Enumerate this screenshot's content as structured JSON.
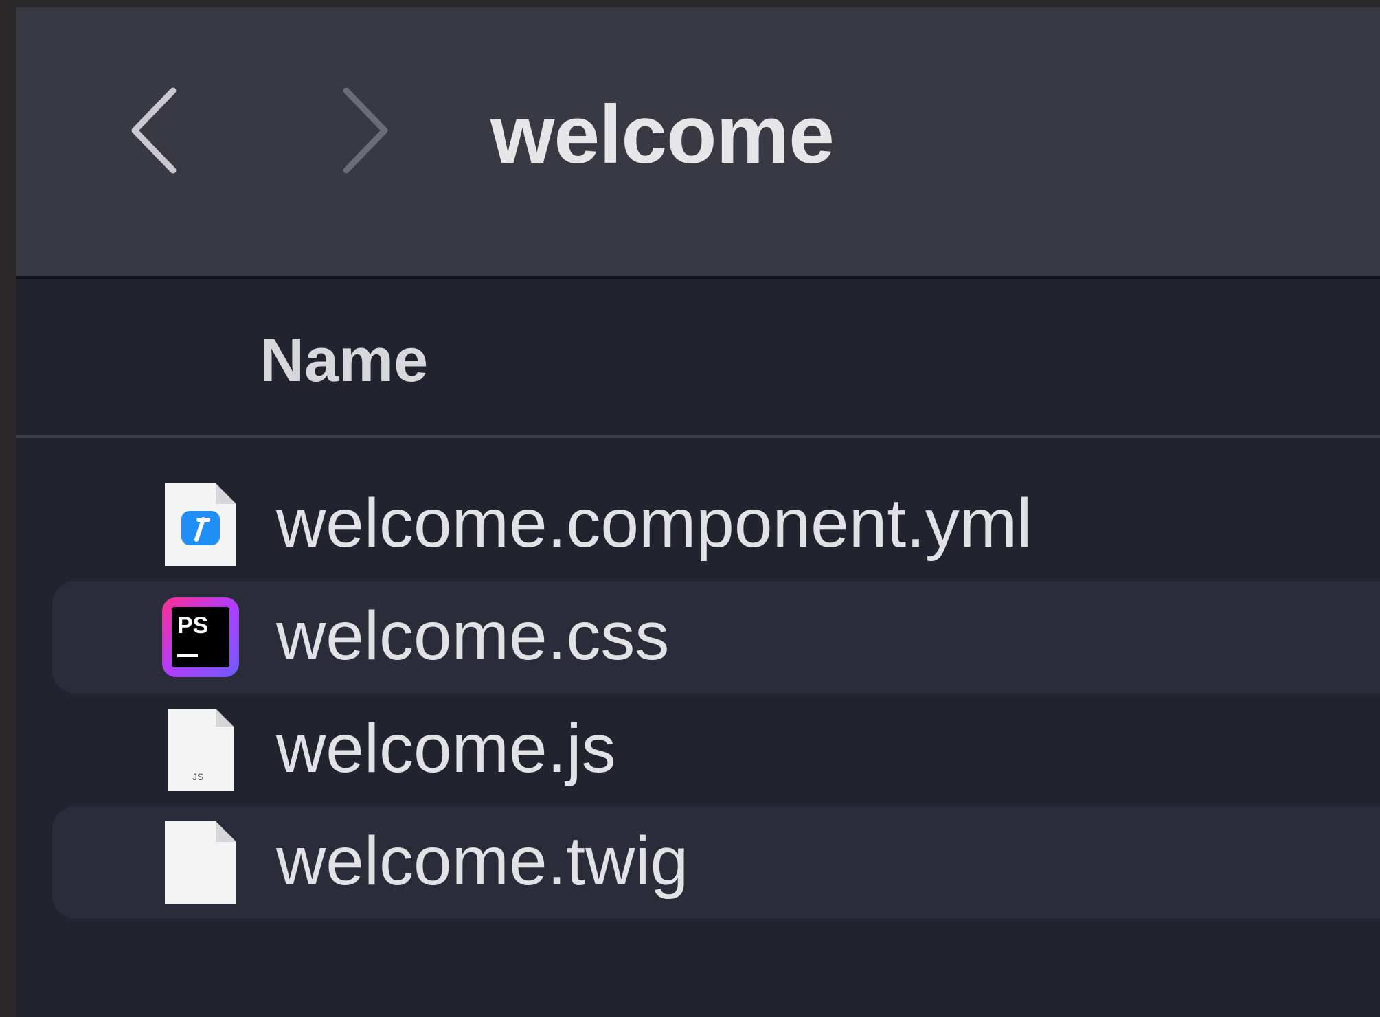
{
  "window": {
    "title": "welcome"
  },
  "navigation": {
    "back_icon": "chevron-left-icon",
    "forward_icon": "chevron-right-icon"
  },
  "columns": {
    "name": "Name"
  },
  "files": [
    {
      "name": "welcome.component.yml",
      "icon": "yml-file-icon"
    },
    {
      "name": "welcome.css",
      "icon": "phpstorm-css-file-icon",
      "icon_label": "PS"
    },
    {
      "name": "welcome.js",
      "icon": "js-file-icon",
      "icon_label": "JS"
    },
    {
      "name": "welcome.twig",
      "icon": "generic-file-icon"
    }
  ],
  "colors": {
    "toolbar_bg": "#393944",
    "list_bg": "#21232f",
    "alt_row_bg": "#2a2c39",
    "text": "#e2e2e6",
    "yml_icon_blue": "#1f8ef7"
  }
}
